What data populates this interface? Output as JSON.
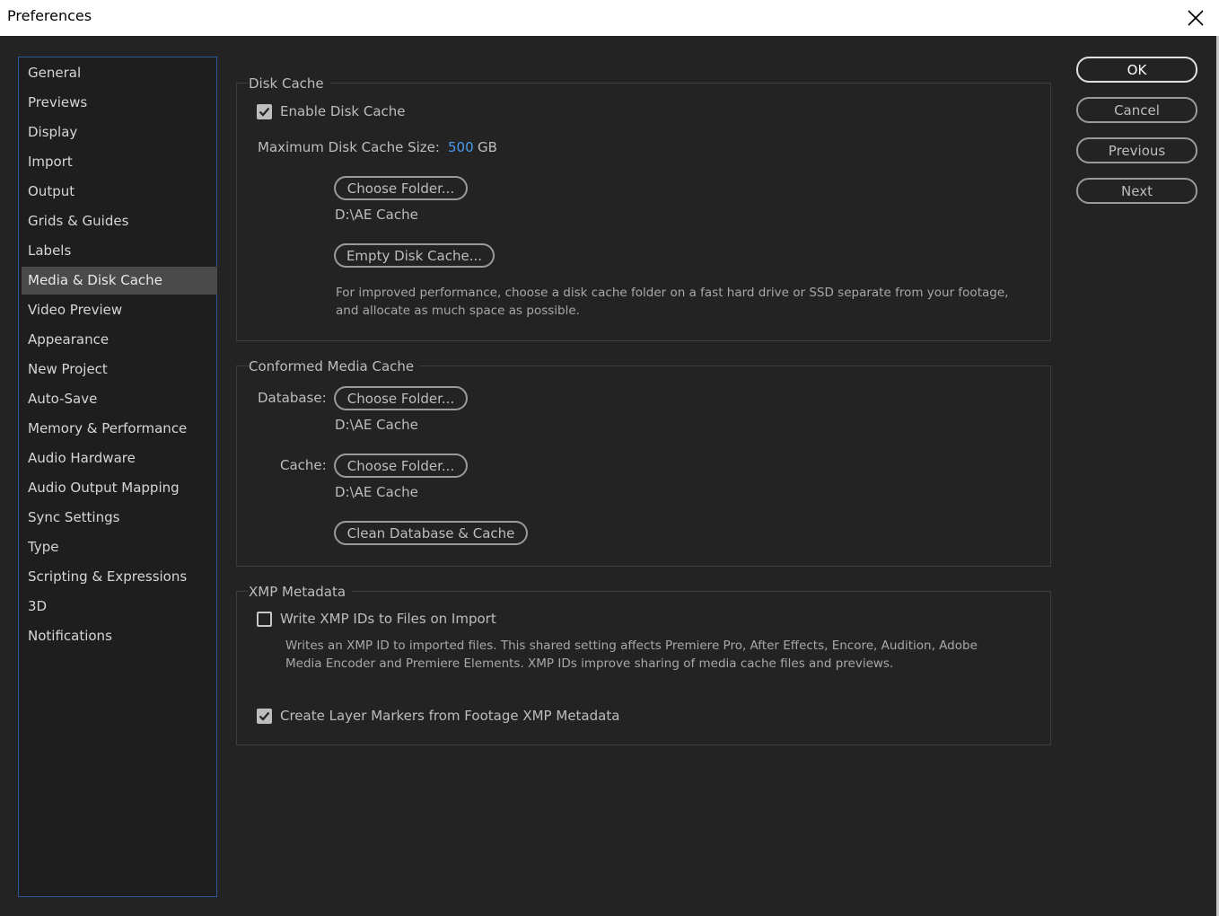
{
  "window": {
    "title": "Preferences",
    "close_icon": "close-icon"
  },
  "sidebar": {
    "items": [
      {
        "label": "General"
      },
      {
        "label": "Previews"
      },
      {
        "label": "Display"
      },
      {
        "label": "Import"
      },
      {
        "label": "Output"
      },
      {
        "label": "Grids & Guides"
      },
      {
        "label": "Labels"
      },
      {
        "label": "Media & Disk Cache",
        "selected": true
      },
      {
        "label": "Video Preview"
      },
      {
        "label": "Appearance"
      },
      {
        "label": "New Project"
      },
      {
        "label": "Auto-Save"
      },
      {
        "label": "Memory & Performance"
      },
      {
        "label": "Audio Hardware"
      },
      {
        "label": "Audio Output Mapping"
      },
      {
        "label": "Sync Settings"
      },
      {
        "label": "Type"
      },
      {
        "label": "Scripting & Expressions"
      },
      {
        "label": "3D"
      },
      {
        "label": "Notifications"
      }
    ]
  },
  "disk_cache": {
    "title": "Disk Cache",
    "enable_label": "Enable Disk Cache",
    "enable_checked": true,
    "max_size_label": "Maximum Disk Cache Size:",
    "max_size_value": "500",
    "max_size_unit": "GB",
    "choose_folder_label": "Choose Folder...",
    "folder_path": "D:\\AE Cache",
    "empty_cache_label": "Empty Disk Cache...",
    "info_line1": "For improved performance, choose a disk cache folder on a fast hard drive or SSD separate from your footage,",
    "info_line2": "and allocate as much space as possible."
  },
  "conformed_media_cache": {
    "title": "Conformed Media Cache",
    "database_label": "Database:",
    "database_button": "Choose Folder...",
    "database_path": "D:\\AE Cache",
    "cache_label": "Cache:",
    "cache_button": "Choose Folder...",
    "cache_path": "D:\\AE Cache",
    "clean_button": "Clean Database & Cache"
  },
  "xmp_metadata": {
    "title": "XMP Metadata",
    "write_ids_label": "Write XMP IDs to Files on Import",
    "write_ids_checked": false,
    "write_ids_info_line1": "Writes an XMP ID to imported files. This shared setting affects Premiere Pro, After Effects, Encore, Audition, Adobe",
    "write_ids_info_line2": "Media Encoder and Premiere Elements. XMP IDs improve sharing of media cache files and previews.",
    "layer_markers_label": "Create Layer Markers from Footage XMP Metadata",
    "layer_markers_checked": true
  },
  "actions": {
    "ok": "OK",
    "cancel": "Cancel",
    "previous": "Previous",
    "next": "Next"
  }
}
